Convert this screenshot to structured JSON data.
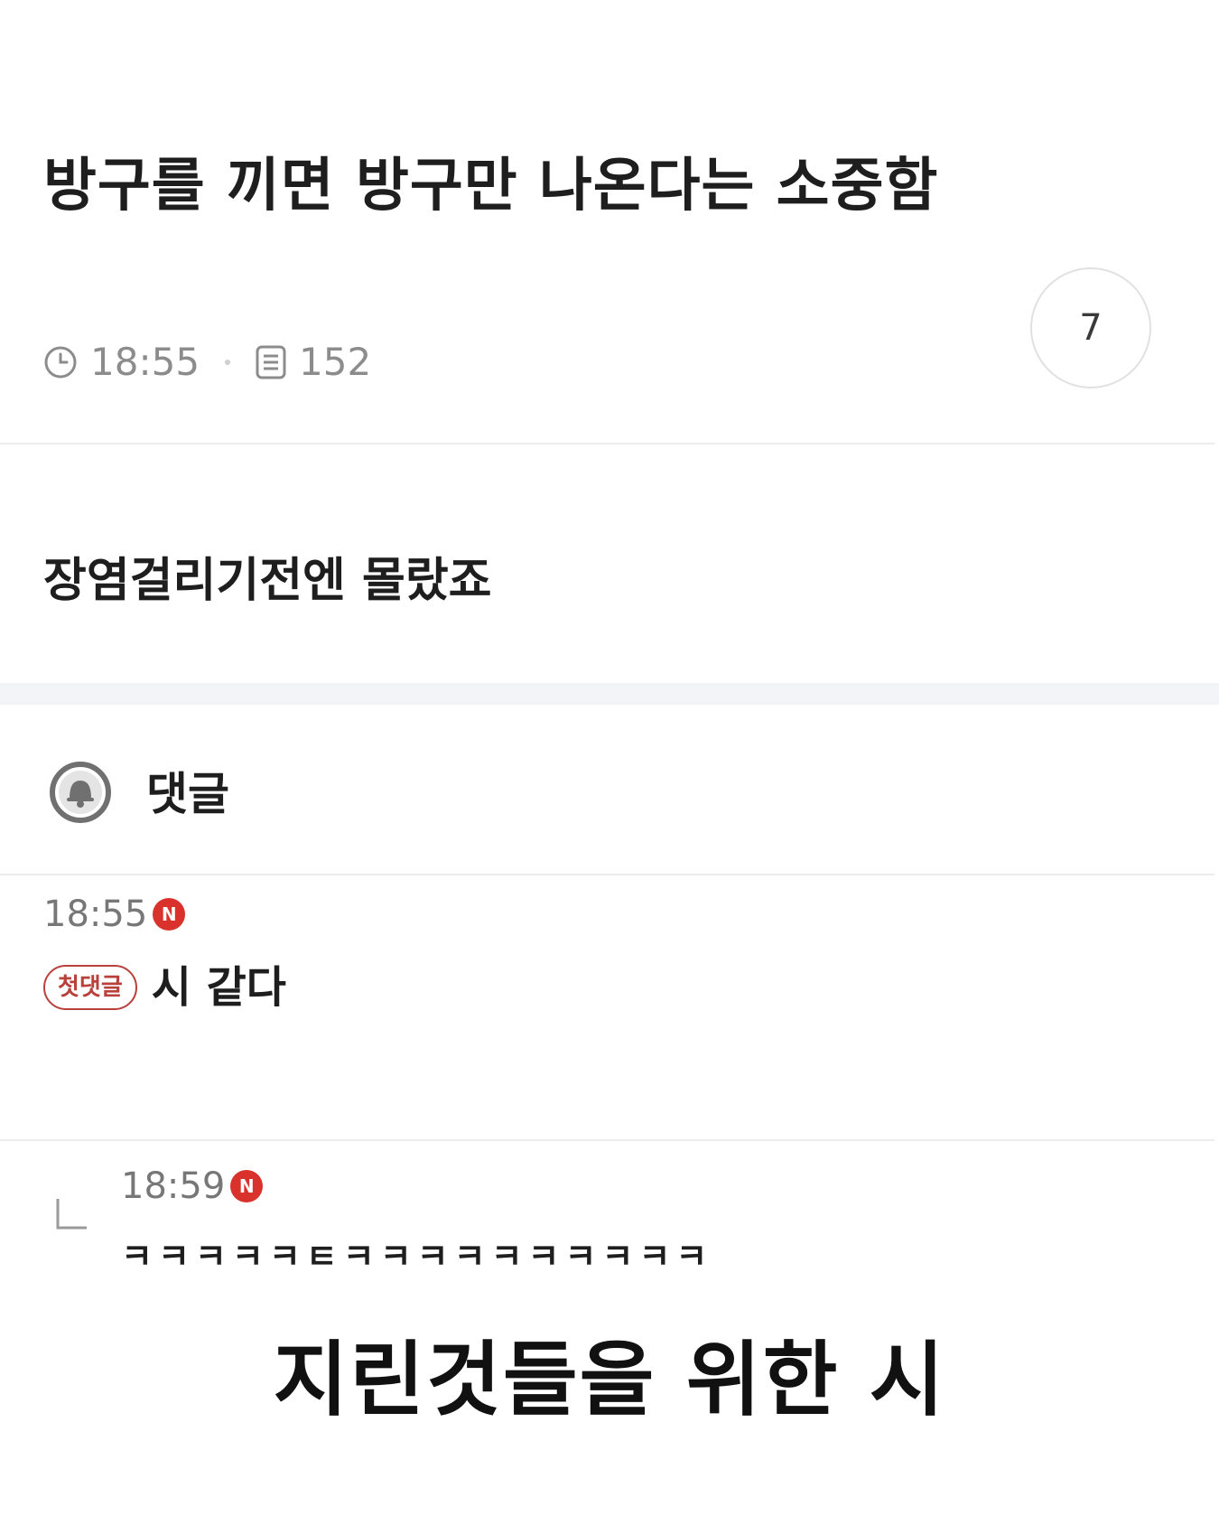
{
  "post": {
    "title": "방구를 끼면 방구만 나온다는 소중함",
    "time": "18:55",
    "views": "152",
    "comment_count": "7",
    "body": "장염걸리기전엔 몰랐죠"
  },
  "comments_section": {
    "title": "댓글",
    "icon": "bell-icon"
  },
  "comments": [
    {
      "time": "18:55",
      "new_badge": "N",
      "first_badge": "첫댓글",
      "text": "시 같다"
    },
    {
      "time": "18:59",
      "new_badge": "N",
      "text": "ㅋㅋㅋㅋㅋㅌㅋㅋㅋㅋㅋㅋㅋㅋㅋㅋ",
      "is_reply": true
    }
  ],
  "caption": "지린것들을 위한 시",
  "colors": {
    "new_badge": "#d9312b",
    "first_badge": "#b9413c",
    "meta_text": "#8c8c8c"
  }
}
